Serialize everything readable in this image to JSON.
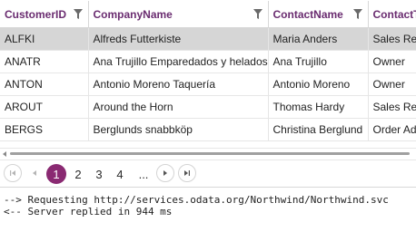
{
  "grid": {
    "columns": [
      {
        "label": "CustomerID"
      },
      {
        "label": "CompanyName"
      },
      {
        "label": "ContactName"
      },
      {
        "label": "ContactTitle"
      }
    ],
    "rows": [
      {
        "id": "ALFKI",
        "company": "Alfreds Futterkiste",
        "contact": "Maria Anders",
        "title": "Sales Representative",
        "selected": true
      },
      {
        "id": "ANATR",
        "company": "Ana Trujillo Emparedados y helados",
        "contact": "Ana Trujillo",
        "title": "Owner"
      },
      {
        "id": "ANTON",
        "company": "Antonio Moreno Taquería",
        "contact": "Antonio Moreno",
        "title": "Owner"
      },
      {
        "id": "AROUT",
        "company": "Around the Horn",
        "contact": "Thomas Hardy",
        "title": "Sales Representative"
      },
      {
        "id": "BERGS",
        "company": "Berglunds snabbköp",
        "contact": "Christina Berglund",
        "title": "Order Administrator"
      }
    ]
  },
  "pager": {
    "pages": [
      "1",
      "2",
      "3",
      "4",
      "..."
    ],
    "current_page": "1"
  },
  "console": {
    "lines": [
      "--> Requesting http://services.odata.org/Northwind/Northwind.svc",
      "<-- Server replied in 944 ms"
    ]
  },
  "colors": {
    "header_text": "#6a2c70",
    "current_page_bg": "#8a2a72",
    "selected_row_bg": "#d6d6d6"
  }
}
